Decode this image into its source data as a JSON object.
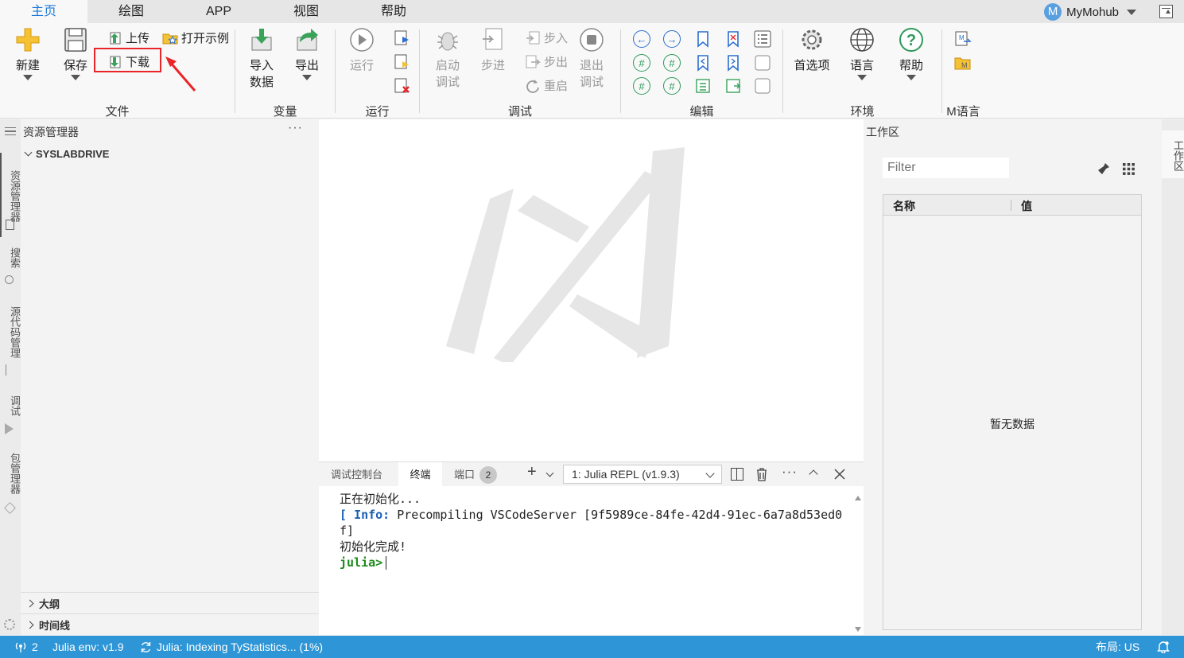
{
  "tabs": [
    "主页",
    "绘图",
    "APP",
    "视图",
    "帮助"
  ],
  "active_tab": "主页",
  "user": {
    "initial": "M",
    "name": "MyMohub"
  },
  "ribbon": {
    "file": {
      "new": "新建",
      "save": "保存",
      "upload": "上传",
      "download": "下载",
      "open_example": "打开示例",
      "group": "文件"
    },
    "variable": {
      "import": [
        "导入",
        "数据"
      ],
      "export": "导出",
      "group": "变量"
    },
    "run": {
      "run": "运行",
      "group": "运行"
    },
    "debug": {
      "start": [
        "启动",
        "调试"
      ],
      "step": "步进",
      "step_in": "步入",
      "step_out": "步出",
      "restart": "重启",
      "exit": [
        "退出",
        "调试"
      ],
      "group": "调试"
    },
    "edit": {
      "group": "编辑"
    },
    "env": {
      "prefs": "首选项",
      "lang": "语言",
      "help": "帮助",
      "group": "环境"
    },
    "mlang": {
      "group": "M语言"
    }
  },
  "activity": [
    "资源管理器",
    "搜索",
    "源代码管理",
    "调试",
    "包管理器"
  ],
  "explorer": {
    "title": "资源管理器",
    "more": "···",
    "root": "SYSLABDRIVE",
    "outline": "大纲",
    "timeline": "时间线"
  },
  "panel": {
    "tabs": {
      "debug_console": "调试控制台",
      "terminal": "终端",
      "ports": "端口"
    },
    "ports_badge": "2",
    "terminal_select": "1: Julia REPL (v1.9.3)",
    "lines": {
      "l1": "正在初始化...",
      "l2_bracket": "[ ",
      "l2_info": "Info:",
      "l2_rest": " Precompiling VSCodeServer [9f5989ce-84fe-42d4-91ec-6a7a8d53ed0",
      "l3": "f]",
      "l4": "初始化完成!",
      "prompt": "julia>"
    }
  },
  "workspace": {
    "title": "工作区",
    "filter_placeholder": "Filter",
    "col_name": "名称",
    "col_value": "值",
    "empty": "暂无数据",
    "side_label": "工作区"
  },
  "status": {
    "remote_count": "2",
    "julia_env": "Julia env: v1.9",
    "indexing": "Julia: Indexing TyStatistics... (1%)",
    "layout": "布局: US"
  }
}
